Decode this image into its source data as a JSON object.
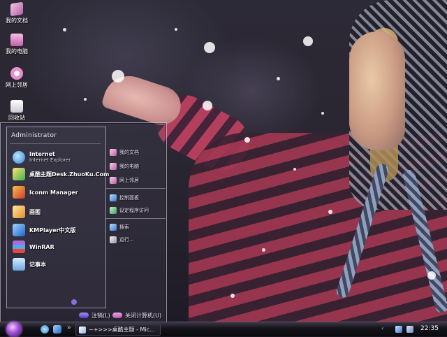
{
  "desktop_icons": [
    {
      "label": "我的文档",
      "icon": "documents-icon"
    },
    {
      "label": "我的电脑",
      "icon": "computer-icon"
    },
    {
      "label": "网上邻居",
      "icon": "network-icon"
    },
    {
      "label": "回收站",
      "icon": "recycle-bin-icon"
    }
  ],
  "start_menu": {
    "user": "Administrator",
    "programs": [
      {
        "title": "Internet",
        "subtitle": "Internet Explorer",
        "icon": "internet-explorer-icon"
      },
      {
        "title": "桌酷主题Desk.ZhuoKu.Com",
        "subtitle": "",
        "icon": "zhuoku-icon"
      },
      {
        "title": "Iconm Manager",
        "subtitle": "",
        "icon": "icon-manager-icon"
      },
      {
        "title": "画图",
        "subtitle": "",
        "icon": "paint-icon"
      },
      {
        "title": "KMPlayer中文版",
        "subtitle": "",
        "icon": "kmplayer-icon"
      },
      {
        "title": "WinRAR",
        "subtitle": "",
        "icon": "winrar-icon"
      },
      {
        "title": "记事本",
        "subtitle": "",
        "icon": "notepad-icon"
      }
    ],
    "places": [
      {
        "label": "我的文档",
        "icon": "documents-icon"
      },
      {
        "label": "我的电脑",
        "icon": "computer-icon"
      },
      {
        "label": "网上邻居",
        "icon": "network-icon"
      },
      {
        "label": "控制面板",
        "icon": "control-panel-icon"
      },
      {
        "label": "设定程序访问",
        "icon": "program-access-icon"
      },
      {
        "label": "搜索",
        "icon": "search-icon"
      },
      {
        "label": "运行...",
        "icon": "run-icon"
      }
    ],
    "logoff_label": "注销(L)",
    "shutdown_label": "关闭计算机(U)"
  },
  "taskbar": {
    "more_label": "»",
    "window_button": "~+>>>桌酷主题 - Mic...",
    "tray_expand": "‹",
    "clock": "22:35"
  },
  "colors": {
    "accent": "#a04dd4",
    "menu_border": "#e6e6ff"
  }
}
